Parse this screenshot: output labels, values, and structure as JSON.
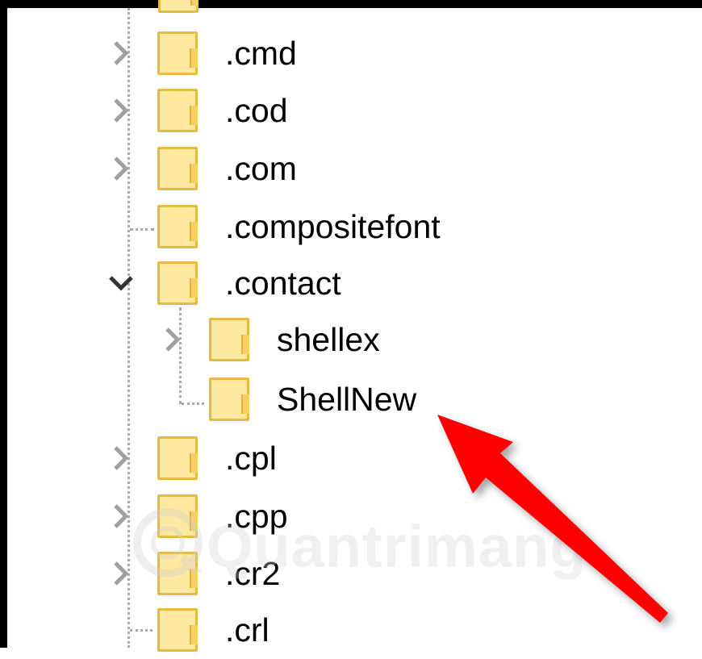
{
  "tree": {
    "items": [
      {
        "label": ".cmd",
        "expander": "collapsed"
      },
      {
        "label": ".cod",
        "expander": "collapsed"
      },
      {
        "label": ".com",
        "expander": "collapsed"
      },
      {
        "label": ".compositefont",
        "expander": "none"
      },
      {
        "label": ".contact",
        "expander": "expanded"
      },
      {
        "label": "shellex",
        "expander": "collapsed",
        "child": true
      },
      {
        "label": "ShellNew",
        "expander": "none",
        "child": true
      },
      {
        "label": ".cpl",
        "expander": "collapsed"
      },
      {
        "label": ".cpp",
        "expander": "collapsed"
      },
      {
        "label": ".cr2",
        "expander": "collapsed"
      },
      {
        "label": ".crl",
        "expander": "none"
      }
    ]
  },
  "icons": {
    "folder": "folder-icon",
    "collapsed": "chevron-right-icon",
    "expanded": "chevron-down-icon",
    "pointer": "red-arrow"
  },
  "colors": {
    "folder_fill": "#ffe8a0",
    "folder_border": "#e6bb44",
    "arrow": "#ff0000",
    "frame": "#000000",
    "chevron": "#a0a0a0",
    "chevron_expanded": "#333333"
  },
  "watermark": {
    "text": "Quantrimang"
  }
}
